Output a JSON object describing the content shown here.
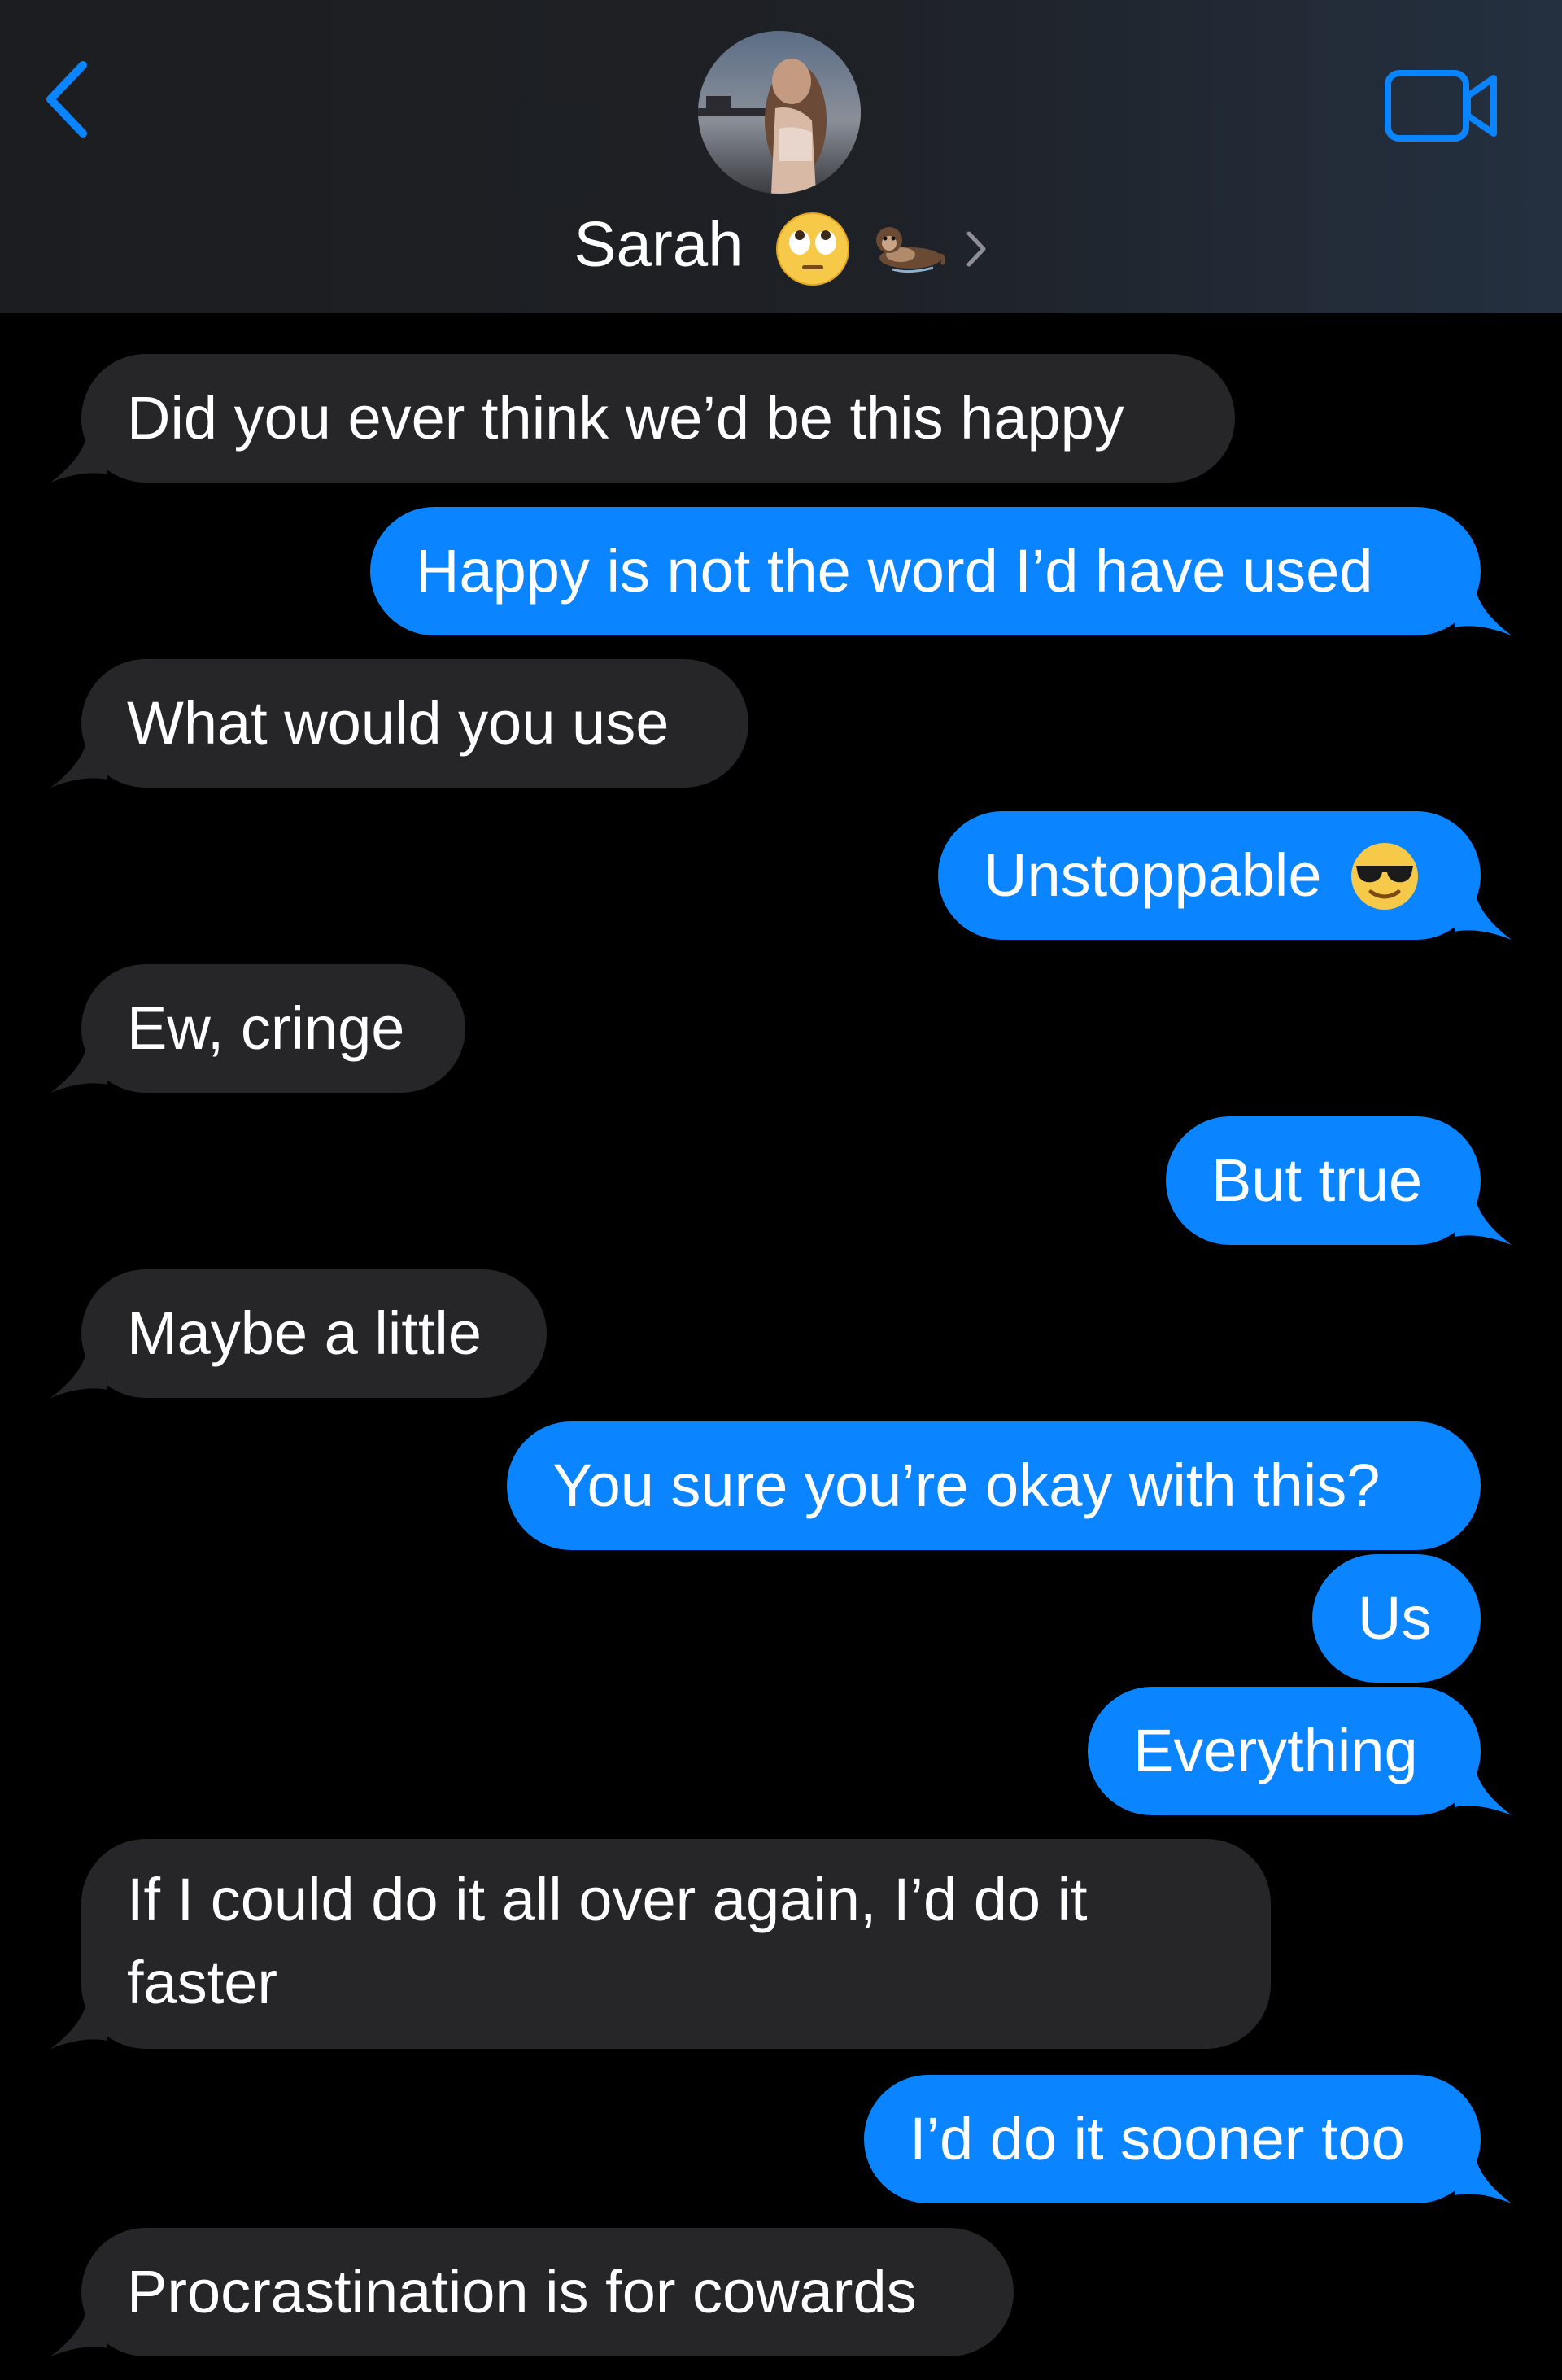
{
  "header": {
    "back_icon": "chevron-left-icon",
    "contact_name": "Sarah",
    "name_emojis": [
      "face-with-rolling-eyes",
      "otter"
    ],
    "disclosure_icon": "chevron-right-icon",
    "video_icon": "video-camera-icon",
    "accent_color": "#0a84ff"
  },
  "colors": {
    "incoming_bubble": "#262629",
    "outgoing_bubble": "#0a84ff",
    "background": "#000000"
  },
  "messages": [
    {
      "direction": "incoming",
      "text": "Did you ever think we’d be this happy"
    },
    {
      "direction": "outgoing",
      "text": "Happy is not the word I’d have used"
    },
    {
      "direction": "incoming",
      "text": "What would you use"
    },
    {
      "direction": "outgoing",
      "text": "Unstoppable",
      "emoji": "smiling-face-with-sunglasses"
    },
    {
      "direction": "incoming",
      "text": "Ew, cringe"
    },
    {
      "direction": "outgoing",
      "text": "But true"
    },
    {
      "direction": "incoming",
      "text": "Maybe a little"
    },
    {
      "direction": "outgoing",
      "text": "You sure you’re okay with this?"
    },
    {
      "direction": "outgoing",
      "text": "Us"
    },
    {
      "direction": "outgoing",
      "text": "Everything"
    },
    {
      "direction": "incoming",
      "text": "If I could do it all over again, I’d do it faster"
    },
    {
      "direction": "outgoing",
      "text": "I’d do it sooner too"
    },
    {
      "direction": "incoming",
      "text": "Procrastination is for cowards"
    }
  ]
}
